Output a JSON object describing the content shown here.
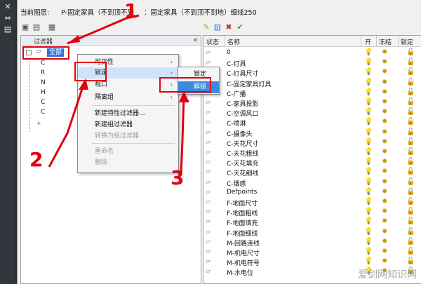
{
  "left_strip": {
    "icons": [
      "close-icon",
      "pin-icon",
      "properties-icon"
    ]
  },
  "header": {
    "current_layer_label": "当前图层:",
    "current_layer_value": "P-固定家具（不到顶不到",
    "current_layer_desc": "：固定家具（不到顶不到地）细线250"
  },
  "filters": {
    "header_label": "过滤器",
    "collapse_glyph": "«",
    "root_label": "全部",
    "tree_letters": [
      "C",
      "R",
      "N",
      "H",
      "C",
      "C"
    ],
    "expander": "+"
  },
  "layers": {
    "columns": [
      "状态",
      "名称",
      "开",
      "冻结",
      "锁定"
    ],
    "rows": [
      "0",
      "C-灯具",
      "C-灯具尺寸",
      "C-固定家具灯具",
      "C-广播",
      "C-家具投影",
      "C-空调风口",
      "C-喷淋",
      "C-摄像头",
      "C-天花尺寸",
      "C-天花粗线",
      "C-天花填充",
      "C-天花细线",
      "C-烟感",
      "Defpoints",
      "F-地面尺寸",
      "F-地面粗线",
      "F-地面填充",
      "F-地面细线",
      "M-回路连线",
      "M-机电尺寸",
      "M-机电符号",
      "M-水电位"
    ]
  },
  "context_menu": {
    "items": [
      {
        "label": "可见性",
        "arrow": "›",
        "disabled": false
      },
      {
        "label": "锁定",
        "arrow": "›",
        "disabled": false
      },
      {
        "label": "视口",
        "arrow": "›",
        "disabled": false
      },
      {
        "label": "隔离组",
        "arrow": "›",
        "disabled": false
      },
      {
        "label": "新建特性过滤器...",
        "arrow": "",
        "disabled": false
      },
      {
        "label": "新建组过滤器",
        "arrow": "",
        "disabled": false
      },
      {
        "label": "转换为组过滤器",
        "arrow": "",
        "disabled": true
      },
      {
        "label": "重命名",
        "arrow": "",
        "disabled": true
      },
      {
        "label": "删除",
        "arrow": "",
        "disabled": true
      }
    ]
  },
  "submenu": {
    "items": [
      "锁定",
      "解锁"
    ]
  },
  "annotations": {
    "numbers": [
      "1",
      "2",
      "3"
    ],
    "color": "#e00010"
  },
  "watermark": "爱剑网知识网"
}
